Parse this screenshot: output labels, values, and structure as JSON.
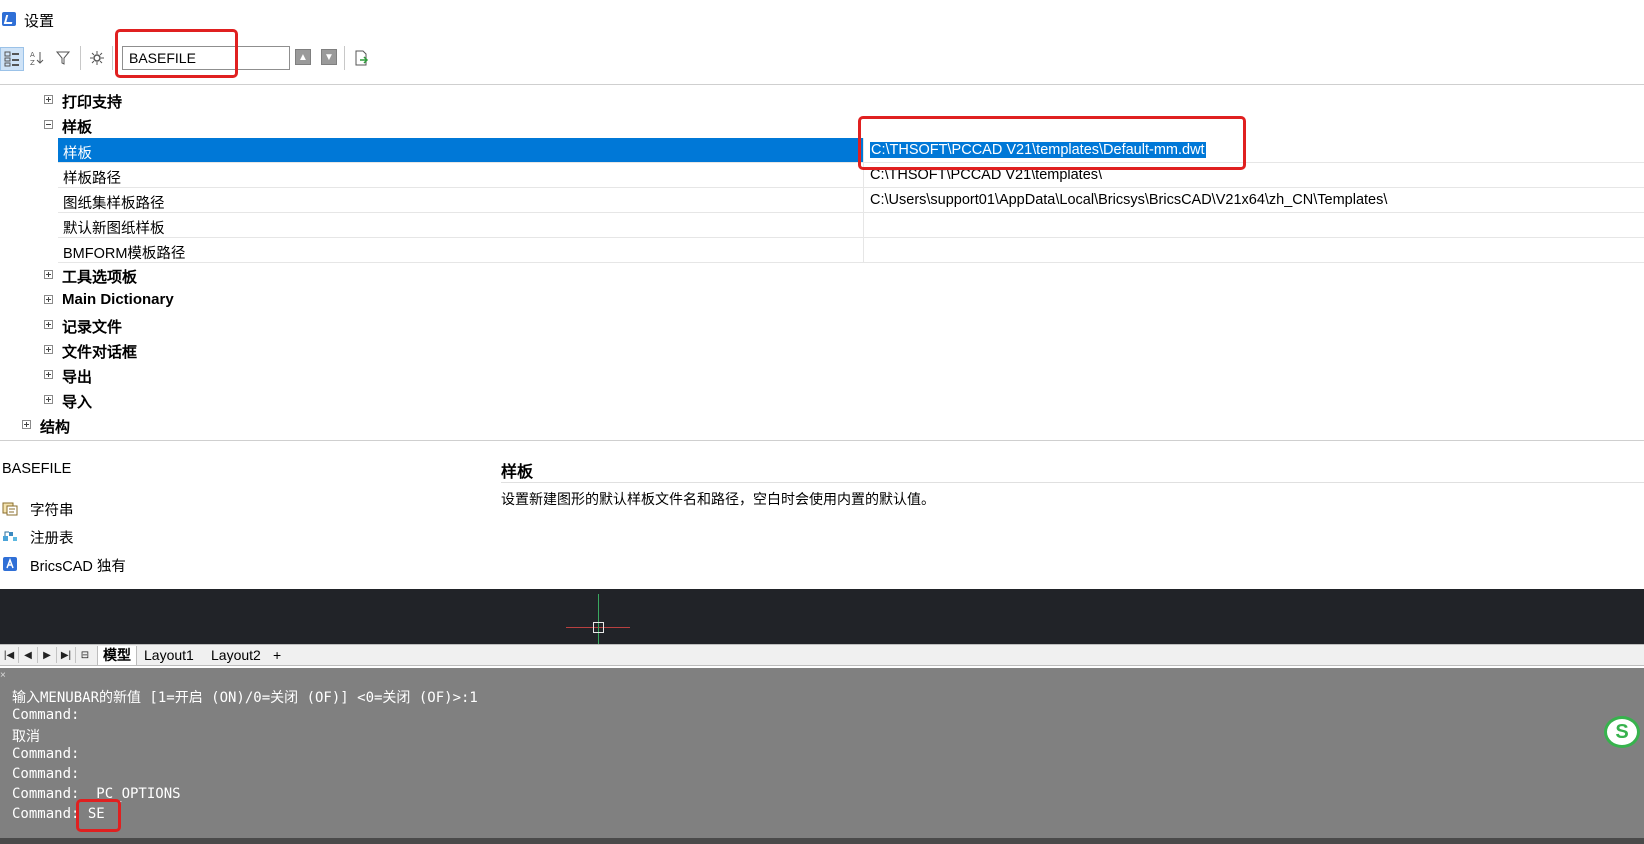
{
  "window": {
    "title": "设置",
    "icon": "bricscad-app-icon"
  },
  "toolbar": {
    "buttons": [
      {
        "name": "categorized-view-icon"
      },
      {
        "name": "alphabetical-sort-icon"
      },
      {
        "name": "filter-icon"
      },
      {
        "name": "settings-gear-icon"
      }
    ],
    "search_value": "BASEFILE",
    "prev_icon": "arrow-up-icon",
    "next_icon": "arrow-down-icon",
    "export_icon": "export-icon"
  },
  "tree": {
    "cat_print": "打印支持",
    "cat_templates": "样板",
    "props": [
      {
        "name": "样板",
        "value": "C:\\THSOFT\\PCCAD V21\\templates\\Default-mm.dwt"
      },
      {
        "name": "样板路径",
        "value": "C:\\THSOFT\\PCCAD V21\\templates\\"
      },
      {
        "name": "图纸集样板路径",
        "value": "C:\\Users\\support01\\AppData\\Local\\Bricsys\\BricsCAD\\V21x64\\zh_CN\\Templates\\"
      },
      {
        "name": "默认新图纸样板",
        "value": ""
      },
      {
        "name": "BMFORM模板路径",
        "value": ""
      }
    ],
    "cat_tools": "工具选项板",
    "cat_dict": "Main Dictionary",
    "cat_log": "记录文件",
    "cat_filedlg": "文件对话框",
    "cat_export": "导出",
    "cat_import": "导入",
    "cat_structure": "结构"
  },
  "info": {
    "varname": "BASEFILE",
    "attrs": [
      {
        "label": "字符串",
        "icon": "string-type-icon"
      },
      {
        "label": "注册表",
        "icon": "registry-icon"
      },
      {
        "label": "BricsCAD 独有",
        "icon": "bricscad-only-icon"
      }
    ],
    "desc_title": "样板",
    "desc_text": "设置新建图形的默认样板文件名和路径，空白时会使用内置的默认值。"
  },
  "layout_tabs": {
    "model": "模型",
    "layout1": "Layout1",
    "layout2": "Layout2",
    "add": "+"
  },
  "command_lines": [
    "输入MENUBAR的新值 [1=开启 (ON)/0=关闭 (OF)] <0=关闭 (OF)>:1",
    "Command:",
    "取消",
    "Command:",
    "Command:",
    "Command: _PC_OPTIONS",
    "Command: SE"
  ],
  "colors": {
    "selection": "#0078d7",
    "highlight_box": "#e02020",
    "drawing_bg": "#212328",
    "command_bg": "#808080"
  }
}
